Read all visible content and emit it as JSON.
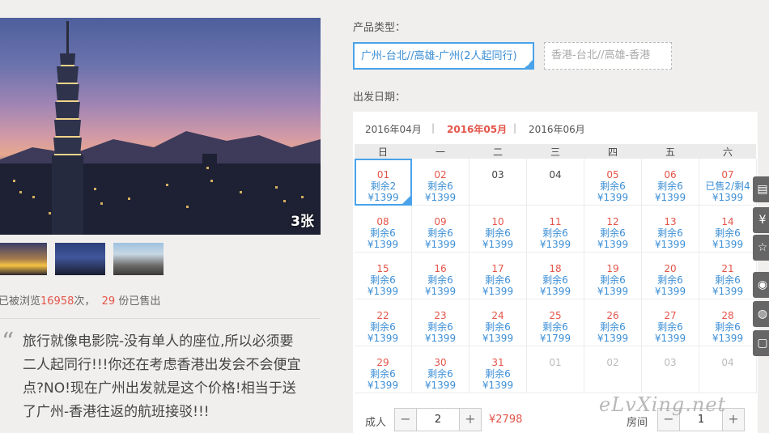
{
  "gallery": {
    "photo_count": "3张"
  },
  "stats": {
    "prefix": "已被浏览",
    "views": "16958",
    "mid": "次，",
    "sold": "29",
    "suffix": "份已售出"
  },
  "quote": {
    "mark": "“",
    "text": "旅行就像电影院-没有单人的座位,所以必须要二人起同行!!!你还在考虑香港出发会不会便宜点?NO!现在广州出发就是这个价格!相当于送了广州-香港往返的航班接驳!!!"
  },
  "product_type": {
    "label": "产品类型：",
    "options": [
      {
        "label": "广州-台北//高雄-广州(2人起同行)",
        "selected": true
      },
      {
        "label": "香港-台北//高雄-香港",
        "selected": false
      }
    ]
  },
  "departure": {
    "label": "出发日期："
  },
  "calendar": {
    "months": [
      "2016年04月",
      "2016年05月",
      "2016年06月"
    ],
    "separator": "|",
    "current_month_index": 1,
    "weekdays": [
      "日",
      "一",
      "二",
      "三",
      "四",
      "五",
      "六"
    ],
    "rows": [
      [
        {
          "day": "01",
          "stock": "剩余2",
          "price": "¥1399",
          "state": "sel"
        },
        {
          "day": "02",
          "stock": "剩余6",
          "price": "¥1399",
          "state": "avail"
        },
        {
          "day": "03",
          "stock": "",
          "price": "",
          "state": "plain"
        },
        {
          "day": "04",
          "stock": "",
          "price": "",
          "state": "plain"
        },
        {
          "day": "05",
          "stock": "剩余6",
          "price": "¥1399",
          "state": "avail"
        },
        {
          "day": "06",
          "stock": "剩余6",
          "price": "¥1399",
          "state": "avail"
        },
        {
          "day": "07",
          "stock": "已售2/剩4",
          "price": "¥1399",
          "state": "avail"
        }
      ],
      [
        {
          "day": "08",
          "stock": "剩余6",
          "price": "¥1399",
          "state": "avail"
        },
        {
          "day": "09",
          "stock": "剩余6",
          "price": "¥1399",
          "state": "avail"
        },
        {
          "day": "10",
          "stock": "剩余6",
          "price": "¥1399",
          "state": "avail"
        },
        {
          "day": "11",
          "stock": "剩余6",
          "price": "¥1399",
          "state": "avail"
        },
        {
          "day": "12",
          "stock": "剩余6",
          "price": "¥1399",
          "state": "avail"
        },
        {
          "day": "13",
          "stock": "剩余6",
          "price": "¥1399",
          "state": "avail"
        },
        {
          "day": "14",
          "stock": "剩余6",
          "price": "¥1399",
          "state": "avail"
        }
      ],
      [
        {
          "day": "15",
          "stock": "剩余6",
          "price": "¥1399",
          "state": "avail"
        },
        {
          "day": "16",
          "stock": "剩余6",
          "price": "¥1399",
          "state": "avail"
        },
        {
          "day": "17",
          "stock": "剩余6",
          "price": "¥1399",
          "state": "avail"
        },
        {
          "day": "18",
          "stock": "剩余6",
          "price": "¥1399",
          "state": "avail"
        },
        {
          "day": "19",
          "stock": "剩余6",
          "price": "¥1399",
          "state": "avail"
        },
        {
          "day": "20",
          "stock": "剩余6",
          "price": "¥1399",
          "state": "avail"
        },
        {
          "day": "21",
          "stock": "剩余6",
          "price": "¥1399",
          "state": "avail"
        }
      ],
      [
        {
          "day": "22",
          "stock": "剩余6",
          "price": "¥1399",
          "state": "avail"
        },
        {
          "day": "23",
          "stock": "剩余6",
          "price": "¥1399",
          "state": "avail"
        },
        {
          "day": "24",
          "stock": "剩余6",
          "price": "¥1399",
          "state": "avail"
        },
        {
          "day": "25",
          "stock": "剩余6",
          "price": "¥1799",
          "state": "avail"
        },
        {
          "day": "26",
          "stock": "剩余6",
          "price": "¥1399",
          "state": "avail"
        },
        {
          "day": "27",
          "stock": "剩余6",
          "price": "¥1399",
          "state": "avail"
        },
        {
          "day": "28",
          "stock": "剩余6",
          "price": "¥1399",
          "state": "avail"
        }
      ],
      [
        {
          "day": "29",
          "stock": "剩余6",
          "price": "¥1399",
          "state": "avail"
        },
        {
          "day": "30",
          "stock": "剩余6",
          "price": "¥1399",
          "state": "avail"
        },
        {
          "day": "31",
          "stock": "剩余6",
          "price": "¥1399",
          "state": "avail"
        },
        {
          "day": "01",
          "stock": "",
          "price": "",
          "state": "off"
        },
        {
          "day": "02",
          "stock": "",
          "price": "",
          "state": "off"
        },
        {
          "day": "03",
          "stock": "",
          "price": "",
          "state": "off"
        },
        {
          "day": "04",
          "stock": "",
          "price": "",
          "state": "off"
        }
      ]
    ]
  },
  "booking": {
    "adult_label": "成人",
    "adult_value": "2",
    "total": "¥2798",
    "room_label": "房间",
    "room_value": "1",
    "minus": "−",
    "plus": "+"
  },
  "side_tools": [
    "clipboard-icon",
    "yen-icon",
    "star-icon",
    "weibo-icon",
    "wechat-icon",
    "chat-icon"
  ],
  "watermark": "eLvXing.net",
  "colors": {
    "accent_blue": "#4aa3ea",
    "price_red": "#e4554a"
  }
}
